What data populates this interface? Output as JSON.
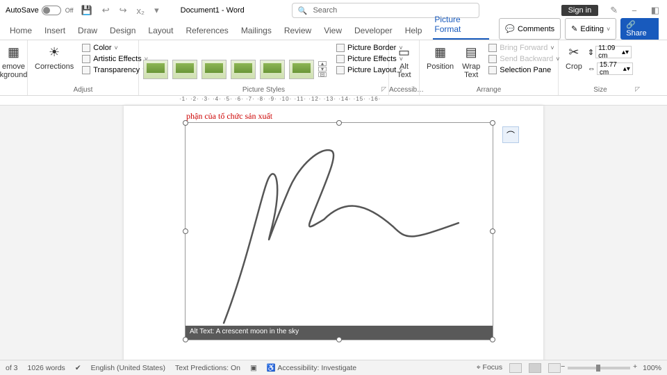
{
  "titlebar": {
    "autosave_label": "AutoSave",
    "autosave_state": "Off",
    "doc_title": "Document1 - Word",
    "search_placeholder": "Search",
    "signin": "Sign in"
  },
  "tabs": {
    "items": [
      "Home",
      "Insert",
      "Draw",
      "Design",
      "Layout",
      "References",
      "Mailings",
      "Review",
      "View",
      "Developer",
      "Help",
      "Picture Format"
    ],
    "active_index": 11,
    "comments": "Comments",
    "editing": "Editing",
    "share": "Share"
  },
  "ribbon": {
    "adjust": {
      "remove_bg": "emove\nkground",
      "corrections": "Corrections",
      "color": "Color",
      "artistic": "Artistic Effects",
      "transparency": "Transparency",
      "label": "Adjust"
    },
    "styles": {
      "border": "Picture Border",
      "effects": "Picture Effects",
      "layout": "Picture Layout",
      "label": "Picture Styles"
    },
    "access": {
      "alt": "Alt\nText",
      "label": "Accessib…"
    },
    "arrange": {
      "position": "Position",
      "wrap": "Wrap\nText",
      "forward": "Bring Forward",
      "backward": "Send Backward",
      "selection": "Selection Pane",
      "label": "Arrange"
    },
    "size": {
      "crop": "Crop",
      "height": "11.09 cm",
      "width": "15.77 cm",
      "label": "Size"
    }
  },
  "ruler": "·1· ·2· ·3· ·4· ·5· ·6· ·7· ·8· ·9· ·10· ·11· ·12· ·13· ·14· ·15· ·16·",
  "document": {
    "red_line": "phận của tổ chức sản xuất",
    "alt_text": "Alt Text: A crescent moon in the sky"
  },
  "status": {
    "page": "of 3",
    "words": "1026 words",
    "lang": "English (United States)",
    "predictions": "Text Predictions: On",
    "accessibility": "Accessibility: Investigate",
    "focus": "Focus",
    "zoom": "100%"
  }
}
